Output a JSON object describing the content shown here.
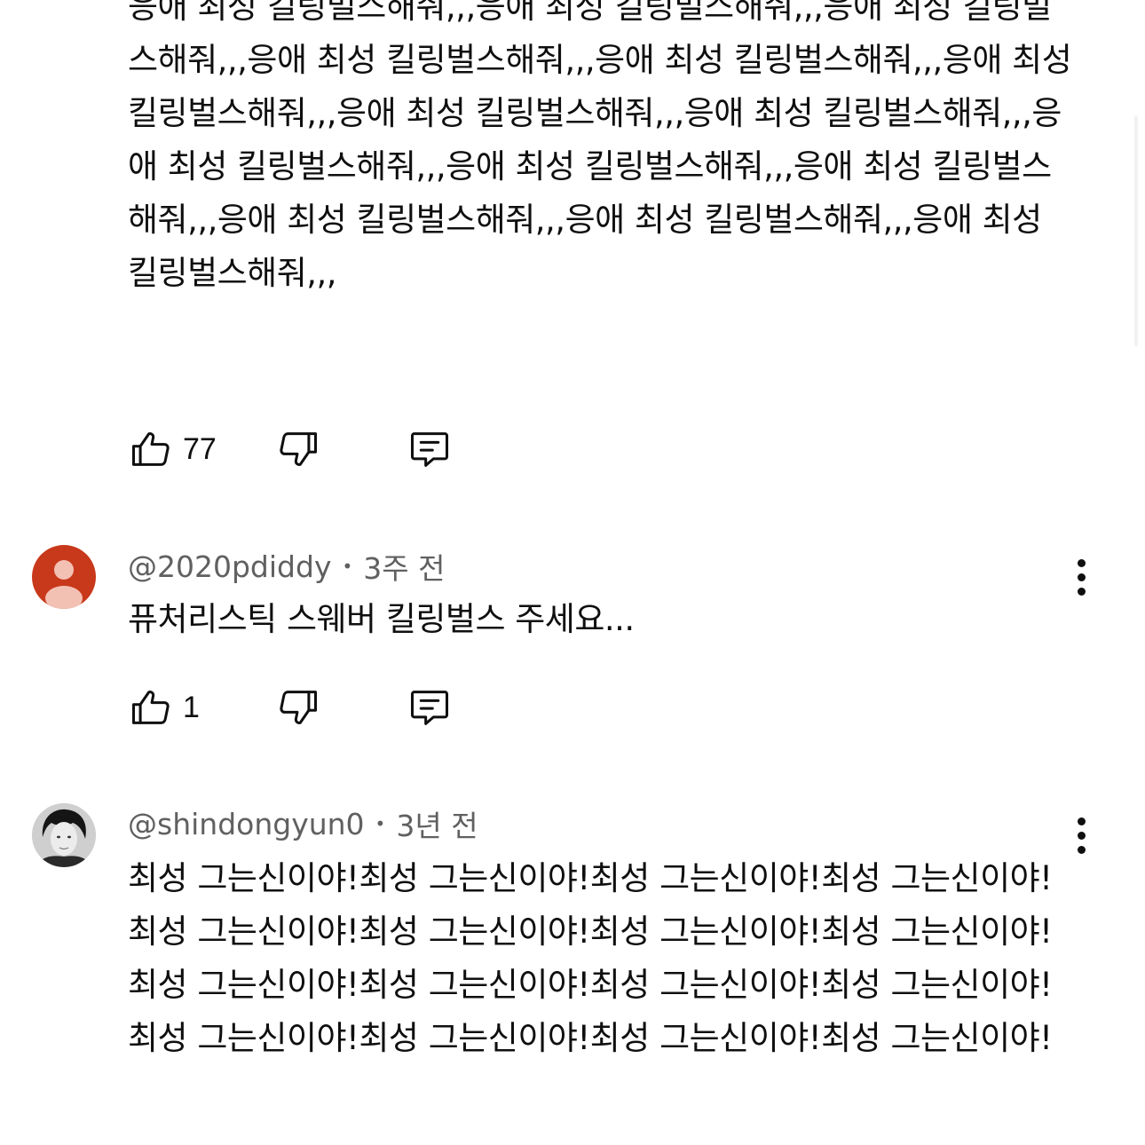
{
  "comments": [
    {
      "text": "응애 최성 킬링벌스해줘,,,응애 최성 킬링벌스해줘,,,응애 최성 킬링벌스해줘,,,응애 최성 킬링벌스해줘,,,응애 최성 킬링벌스해줘,,,응애 최성 킬링벌스해줘,,,응애 최성 킬링벌스해줘,,,응애 최성 킬링벌스해줘,,,응애 최성 킬링벌스해줘,,,응애 최성 킬링벌스해줘,,,응애 최성 킬링벌스해줘,,,응애 최성 킬링벌스해줘,,,응애 최성 킬링벌스해줘,,,응애 최성 킬링벌스해줘,,,",
      "likes": "77",
      "actions": {
        "like_icon": "thumbs-up-icon",
        "dislike_icon": "thumbs-down-icon",
        "reply_icon": "reply-icon"
      }
    },
    {
      "author": "@2020pdiddy",
      "time": "3주 전",
      "text": "퓨처리스틱 스웨버 킬링벌스 주세요...",
      "likes": "1",
      "avatar_color": "#c8381a"
    },
    {
      "author": "@shindongyun0",
      "time": "3년 전",
      "text": "최성 그는신이야!최성 그는신이야!최성 그는신이야!최성 그는신이야!최성 그는신이야!최성 그는신이야!최성 그는신이야!최성 그는신이야!최성 그는신이야!최성 그는신이야!최성 그는신이야!최성 그는신이야!최성 그는신이야!최성 그는신이야!최성 그는신이야!최성 그는신이야!"
    }
  ],
  "separator": "•"
}
